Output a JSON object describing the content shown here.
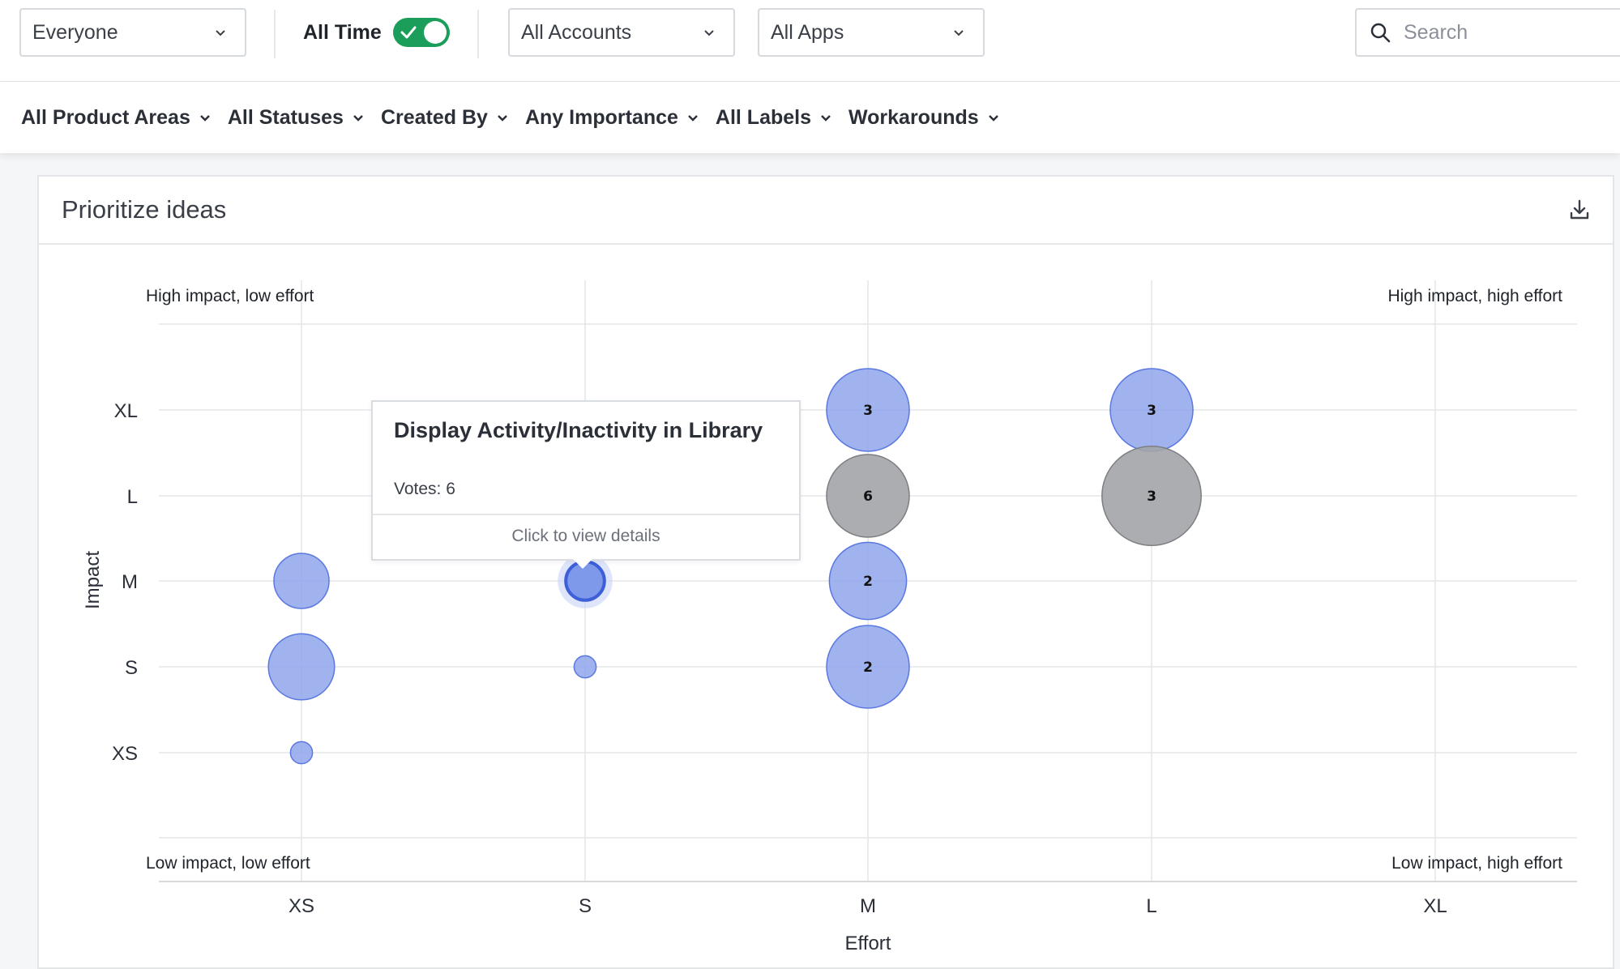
{
  "filters_top": {
    "audience": "Everyone",
    "time_label": "All Time",
    "time_enabled": true,
    "accounts": "All Accounts",
    "apps": "All Apps",
    "search_placeholder": "Search"
  },
  "filters_secondary": [
    {
      "label": "All Product Areas"
    },
    {
      "label": "All Statuses"
    },
    {
      "label": "Created By"
    },
    {
      "label": "Any Importance"
    },
    {
      "label": "All Labels"
    },
    {
      "label": "Workarounds"
    }
  ],
  "card": {
    "title": "Prioritize ideas"
  },
  "tooltip": {
    "title": "Display Activity/Inactivity in Library",
    "votes": "Votes: 6",
    "action": "Click to view details"
  },
  "colors": {
    "toggle_on": "#1a9e5a",
    "bubble_blue": "#8fa6ec",
    "bubble_blue_stroke": "#5a78e0",
    "bubble_gray": "#a2a4a8",
    "bubble_gray_stroke": "#7c7e82"
  },
  "chart_data": {
    "type": "scatter",
    "xlabel": "Effort",
    "ylabel": "Impact",
    "x_categories": [
      "XS",
      "S",
      "M",
      "L",
      "XL"
    ],
    "y_categories": [
      "XS",
      "S",
      "M",
      "L",
      "XL"
    ],
    "quadrant_labels": {
      "top_left": "High impact, low effort",
      "top_right": "High impact, high effort",
      "bottom_left": "Low impact, low effort",
      "bottom_right": "Low impact, high effort"
    },
    "points": [
      {
        "x": "XS",
        "y": "M",
        "size": 2,
        "color": "blue",
        "label": ""
      },
      {
        "x": "XS",
        "y": "S",
        "size": 2.4,
        "color": "blue",
        "label": ""
      },
      {
        "x": "XS",
        "y": "XS",
        "size": 0.8,
        "color": "blue",
        "label": ""
      },
      {
        "x": "S",
        "y": "L",
        "size": 1.6,
        "color": "faded",
        "label": ""
      },
      {
        "x": "S",
        "y": "M",
        "size": 1.4,
        "color": "highlight",
        "label": ""
      },
      {
        "x": "S",
        "y": "S",
        "size": 0.8,
        "color": "blue",
        "label": ""
      },
      {
        "x": "M",
        "y": "XL",
        "size": 3,
        "color": "blue",
        "label": "3"
      },
      {
        "x": "M",
        "y": "L",
        "size": 3,
        "color": "gray",
        "label": "6"
      },
      {
        "x": "M",
        "y": "M",
        "size": 2.8,
        "color": "blue",
        "label": "2"
      },
      {
        "x": "M",
        "y": "S",
        "size": 3,
        "color": "blue",
        "label": "2"
      },
      {
        "x": "L",
        "y": "XL",
        "size": 3,
        "color": "blue",
        "label": "3"
      },
      {
        "x": "L",
        "y": "L",
        "size": 3.6,
        "color": "gray",
        "label": "3"
      }
    ]
  }
}
